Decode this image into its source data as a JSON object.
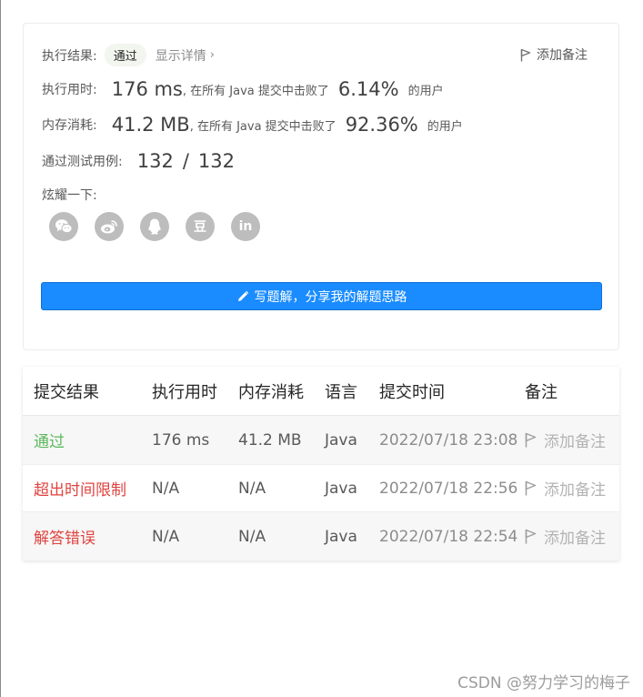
{
  "result": {
    "label": "执行结果:",
    "status": "通过",
    "detail": "显示详情",
    "chevron": "›",
    "add_note": "添加备注"
  },
  "runtime": {
    "label": "执行用时:",
    "value": "176 ms",
    "mid": ", 在所有 Java 提交中击败了",
    "percent": "6.14%",
    "suffix": "的用户"
  },
  "memory": {
    "label": "内存消耗:",
    "value": "41.2 MB",
    "mid": ", 在所有 Java 提交中击败了",
    "percent": "92.36%",
    "suffix": "的用户"
  },
  "tests": {
    "label": "通过测试用例:",
    "passed": "132",
    "sep": "/",
    "total": "132"
  },
  "share": {
    "label": "炫耀一下:",
    "icons": [
      "wechat-icon",
      "weibo-icon",
      "qq-icon",
      "douban-icon",
      "linkedin-icon"
    ],
    "douban_text": "豆",
    "linkedin_text": "in"
  },
  "write_button": "写题解，分享我的解题思路",
  "table": {
    "headers": [
      "提交结果",
      "执行用时",
      "内存消耗",
      "语言",
      "提交时间",
      "备注"
    ],
    "rows": [
      {
        "result": "通过",
        "status": "accepted",
        "runtime": "176 ms",
        "memory": "41.2 MB",
        "lang": "Java",
        "time": "2022/07/18 23:08",
        "note": "添加备注"
      },
      {
        "result": "超出时间限制",
        "status": "error",
        "runtime": "N/A",
        "memory": "N/A",
        "lang": "Java",
        "time": "2022/07/18 22:56",
        "note": "添加备注"
      },
      {
        "result": "解答错误",
        "status": "error",
        "runtime": "N/A",
        "memory": "N/A",
        "lang": "Java",
        "time": "2022/07/18 22:54",
        "note": "添加备注"
      }
    ]
  },
  "colors": {
    "accepted": "#5cb85c",
    "error": "#e0433f",
    "primary_button": "#1a8cff",
    "share_icon_bg": "#bdbdbd"
  },
  "watermark": "CSDN @努力学习的梅子"
}
